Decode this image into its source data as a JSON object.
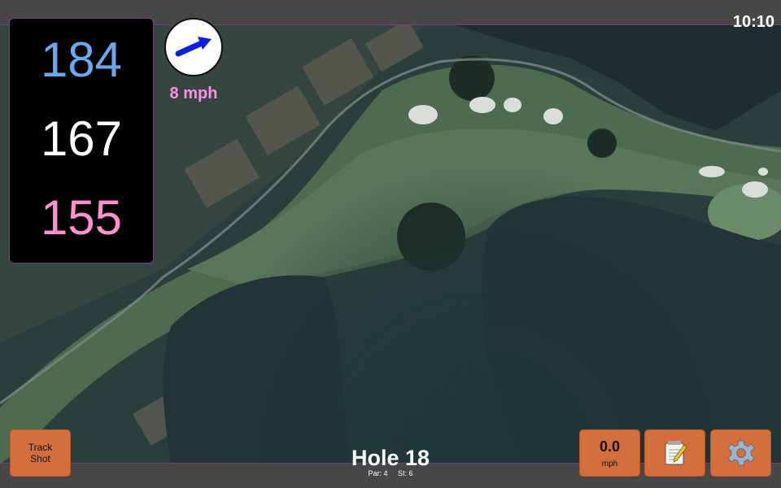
{
  "clock": "10:10",
  "distances": {
    "back": "184",
    "middle": "167",
    "front": "155"
  },
  "wind": {
    "speed_text": "8 mph",
    "direction_icon": "arrow-right-icon"
  },
  "hole": {
    "title": "Hole 18",
    "par_text": "Par: 4",
    "si_text": "SI: 6"
  },
  "buttons": {
    "track_shot_line1": "Track",
    "track_shot_line2": "Shot",
    "speed_value": "0.0",
    "speed_unit": "mph",
    "notes_icon": "notepad-icon",
    "settings_icon": "gear-icon"
  },
  "colors": {
    "back_distance": "#6aa8ee",
    "middle_distance": "#ffffff",
    "front_distance": "#ff8fd0",
    "wind_text": "#ff8fe6",
    "button": "#d46e3c"
  }
}
